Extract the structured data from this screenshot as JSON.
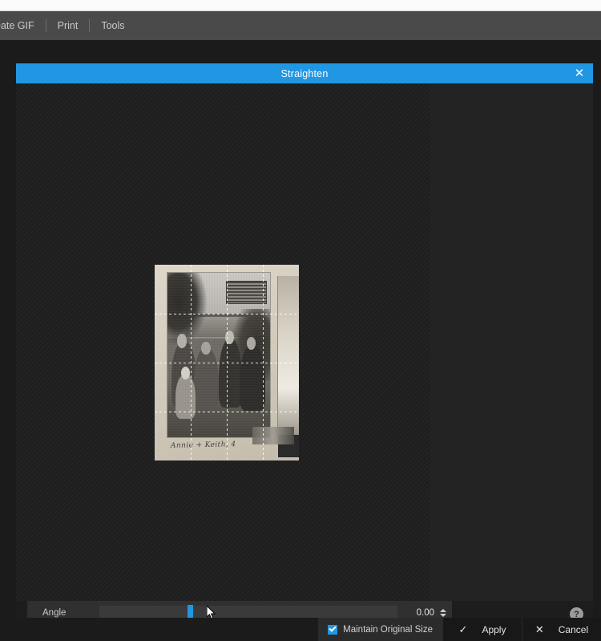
{
  "menubar": {
    "items": [
      {
        "label": "eate GIF",
        "name": "create-gif"
      },
      {
        "label": "Print",
        "name": "print"
      },
      {
        "label": "Tools",
        "name": "tools"
      }
    ]
  },
  "dialog": {
    "title": "Straighten",
    "close_icon": "close-icon",
    "close_glyph": "✕"
  },
  "canvas": {
    "photo": {
      "handwriting": "Annie  + Keith, 4",
      "grid": {
        "columns": 4,
        "rows": 4,
        "style": "dashed-white"
      }
    }
  },
  "footer": {
    "angle": {
      "label": "Angle",
      "value": "0.00",
      "slider_position_percent": 29.5,
      "spinner_up_icon": "spinner-up-icon",
      "spinner_down_icon": "spinner-down-icon"
    },
    "help": {
      "glyph": "?",
      "name": "help-icon"
    }
  },
  "actions": {
    "maintain_original_size": {
      "label": "Maintain Original Size",
      "checked": true
    },
    "apply": {
      "label": "Apply",
      "icon_glyph": "✓",
      "icon_name": "check-icon"
    },
    "cancel": {
      "label": "Cancel",
      "icon_glyph": "✕",
      "icon_name": "close-icon"
    }
  },
  "colors": {
    "accent": "#2196e3",
    "toolbar_bg": "#4a4a4a",
    "canvas_bg": "#232323",
    "panel_bg": "#1d1d1d"
  }
}
